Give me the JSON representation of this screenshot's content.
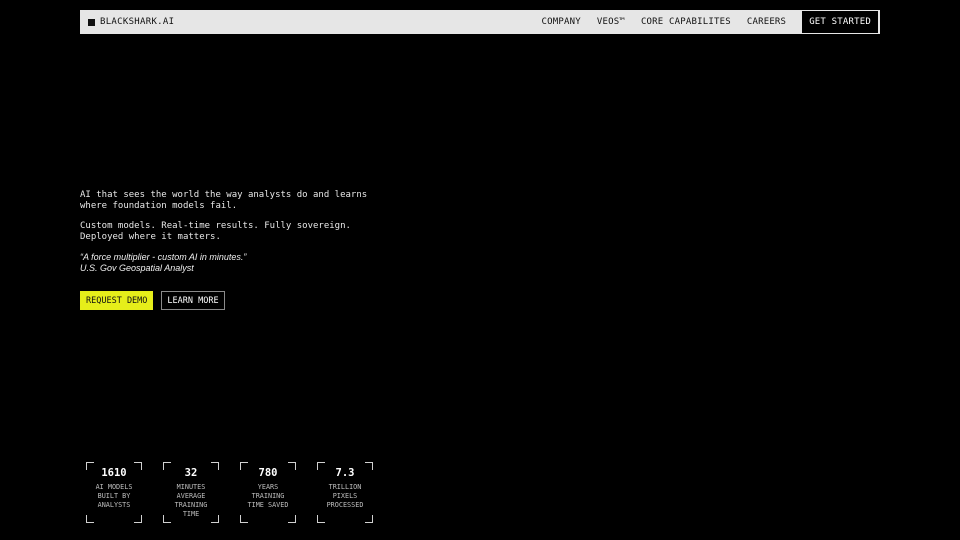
{
  "nav": {
    "brand": "BLACKSHARK.AI",
    "items": [
      "COMPANY",
      "VEOS™",
      "CORE CAPABILITES",
      "CAREERS"
    ],
    "cta": "GET STARTED"
  },
  "hero": {
    "line1": "AI that sees the world the way analysts do and learns where foundation models fail.",
    "line2": "Custom models. Real-time results. Fully sovereign. Deployed where it matters.",
    "quote": "“A force multiplier - custom AI in minutes.”",
    "attribution": "U.S. Gov Geospatial Analyst"
  },
  "buttons": {
    "primary": "REQUEST DEMO",
    "secondary": "LEARN MORE"
  },
  "stats": [
    {
      "value": "1610",
      "label": "AI MODELS BUILT BY ANALYSTS"
    },
    {
      "value": "32",
      "label": "MINUTES AVERAGE TRAINING TIME"
    },
    {
      "value": "780",
      "label": "YEARS TRAINING TIME SAVED"
    },
    {
      "value": "7.3",
      "label": "TRILLION PIXELS PROCESSED"
    }
  ],
  "colors": {
    "background": "#000000",
    "nav_bg": "#e6e6e6",
    "accent": "#e6ee1a"
  }
}
